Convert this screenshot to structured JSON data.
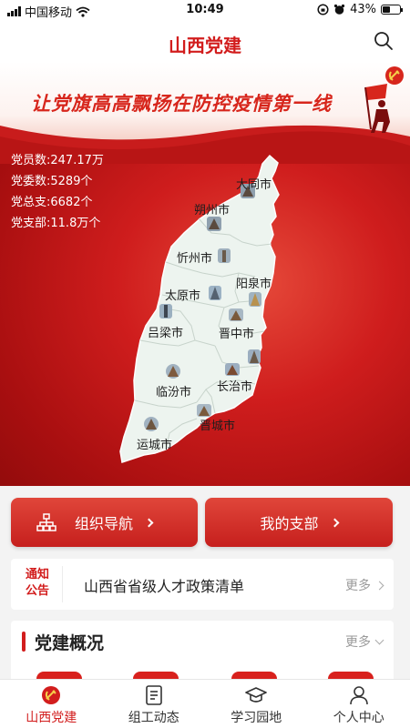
{
  "status_bar": {
    "carrier": "中国移动",
    "time": "10:49",
    "battery": "43%",
    "battery_level": 0.43
  },
  "header": {
    "title": "山西党建"
  },
  "banner": {
    "slogan": "让党旗高高飘扬在防控疫情第一线",
    "stats": [
      {
        "label": "党员数:",
        "value": "247.17万"
      },
      {
        "label": "党委数:",
        "value": "5289个"
      },
      {
        "label": "党总支:",
        "value": "6682个"
      },
      {
        "label": "党支部:",
        "value": "11.8万个"
      }
    ],
    "cities": {
      "datong": "大同市",
      "shuozhou": "朔州市",
      "xinzhou": "忻州市",
      "yangquan": "阳泉市",
      "taiyuan": "太原市",
      "lvliang": "吕梁市",
      "jinzhong": "晋中市",
      "linfen": "临汾市",
      "changzhi": "长治市",
      "jincheng": "晋城市",
      "yuncheng": "运城市"
    }
  },
  "nav_buttons": {
    "org_nav": "组织导航",
    "my_branch": "我的支部"
  },
  "notice": {
    "tag_line1": "通知",
    "tag_line2": "公告",
    "text": "山西省省级人才政策清单",
    "more": "更多"
  },
  "overview": {
    "title": "党建概况",
    "more": "更多"
  },
  "tabbar": [
    {
      "label": "山西党建",
      "icon": "party-emblem-icon",
      "active": true
    },
    {
      "label": "组工动态",
      "icon": "news-icon",
      "active": false
    },
    {
      "label": "学习园地",
      "icon": "graduation-cap-icon",
      "active": false
    },
    {
      "label": "个人中心",
      "icon": "user-icon",
      "active": false
    }
  ],
  "colors": {
    "primary": "#d21d1d",
    "map_fill": "#edf4ef",
    "background": "#f3f3f3"
  }
}
